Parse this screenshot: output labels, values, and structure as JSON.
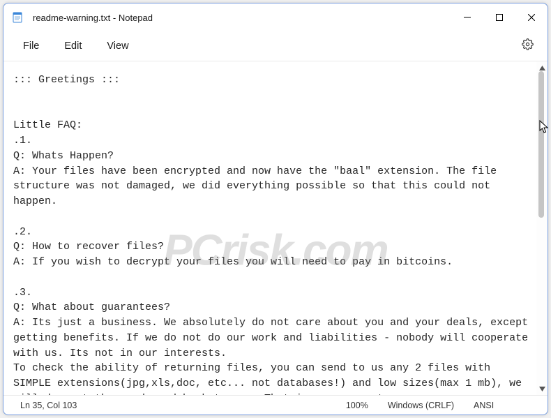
{
  "titlebar": {
    "filename": "readme-warning.txt",
    "appname": "Notepad"
  },
  "menu": {
    "file": "File",
    "edit": "Edit",
    "view": "View"
  },
  "document_text": "::: Greetings :::\n\n\nLittle FAQ:\n.1.\nQ: Whats Happen?\nA: Your files have been encrypted and now have the \"baal\" extension. The file structure was not damaged, we did everything possible so that this could not happen.\n\n.2.\nQ: How to recover files?\nA: If you wish to decrypt your files you will need to pay in bitcoins.\n\n.3.\nQ: What about guarantees?\nA: Its just a business. We absolutely do not care about you and your deals, except getting benefits. If we do not do our work and liabilities - nobody will cooperate with us. Its not in our interests.\nTo check the ability of returning files, you can send to us any 2 files with SIMPLE extensions(jpg,xls,doc, etc... not databases!) and low sizes(max 1 mb), we will decrypt them and send back to you. That is our guarantee.",
  "status": {
    "position": "Ln 35, Col 103",
    "zoom": "100%",
    "line_ending": "Windows (CRLF)",
    "encoding": "ANSI"
  },
  "watermark": "PCrisk.com"
}
